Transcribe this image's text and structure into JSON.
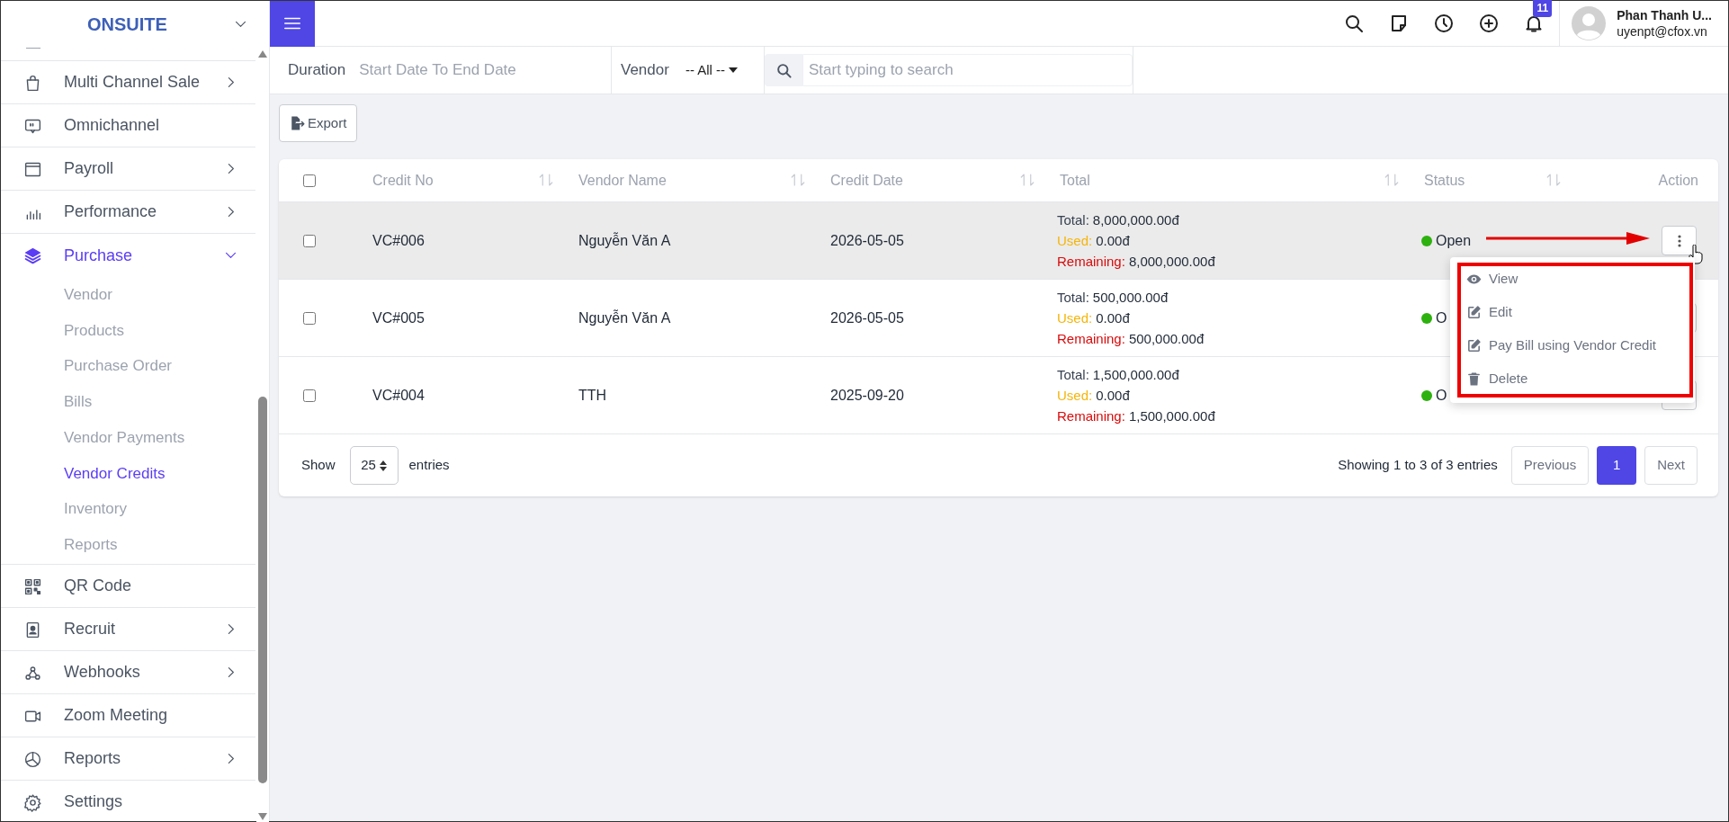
{
  "sidebar": {
    "brand": "ONSUITE",
    "items": [
      {
        "label": "Multi Channel Sale",
        "expanded": false,
        "selected": false
      },
      {
        "label": "Omnichannel",
        "selected": false
      },
      {
        "label": "Payroll",
        "expanded": false,
        "selected": false
      },
      {
        "label": "Performance",
        "expanded": false,
        "selected": false
      },
      {
        "label": "Purchase",
        "expanded": true,
        "selected": true,
        "children": [
          {
            "label": "Vendor",
            "selected": false
          },
          {
            "label": "Products",
            "selected": false
          },
          {
            "label": "Purchase Order",
            "selected": false
          },
          {
            "label": "Bills",
            "selected": false
          },
          {
            "label": "Vendor Payments",
            "selected": false
          },
          {
            "label": "Vendor Credits",
            "selected": true
          },
          {
            "label": "Inventory",
            "selected": false
          },
          {
            "label": "Reports",
            "selected": false
          }
        ]
      },
      {
        "label": "QR Code",
        "selected": false
      },
      {
        "label": "Recruit",
        "expanded": false,
        "selected": false
      },
      {
        "label": "Webhooks",
        "expanded": false,
        "selected": false
      },
      {
        "label": "Zoom Meeting",
        "selected": false
      },
      {
        "label": "Reports",
        "expanded": false,
        "selected": false
      },
      {
        "label": "Settings",
        "selected": false
      }
    ]
  },
  "topbar": {
    "notification_count": "11",
    "user_name": "Phan Thanh U...",
    "user_email": "uyenpt@cfox.vn"
  },
  "filters": {
    "duration_label": "Duration",
    "duration_placeholder": "Start Date To End Date",
    "vendor_label": "Vendor",
    "vendor_value": "-- All --",
    "search_placeholder": "Start typing to search"
  },
  "export_button": "Export",
  "table": {
    "select_all_checked": false,
    "columns": [
      {
        "label": "Credit No",
        "sortable": true
      },
      {
        "label": "Vendor Name",
        "sortable": true
      },
      {
        "label": "Credit Date",
        "sortable": true
      },
      {
        "label": "Total",
        "sortable": true
      },
      {
        "label": "Status",
        "sortable": true
      },
      {
        "label": "Action",
        "sortable": false
      }
    ],
    "rows": [
      {
        "checked": false,
        "highlighted": true,
        "credit_no": "VC#006",
        "vendor": "Nguyễn Văn A",
        "date": "2026-05-05",
        "amounts": [
          {
            "kind": "total",
            "label": "Total:",
            "value": "8,000,000.00đ"
          },
          {
            "kind": "used",
            "label": "Used:",
            "value": "0.00đ"
          },
          {
            "kind": "remaining",
            "label": "Remaining:",
            "value": "8,000,000.00đ"
          }
        ],
        "status": "Open"
      },
      {
        "checked": false,
        "highlighted": false,
        "credit_no": "VC#005",
        "vendor": "Nguyễn Văn A",
        "date": "2026-05-05",
        "amounts": [
          {
            "kind": "total",
            "label": "Total:",
            "value": "500,000.00đ"
          },
          {
            "kind": "used",
            "label": "Used:",
            "value": "0.00đ"
          },
          {
            "kind": "remaining",
            "label": "Remaining:",
            "value": "500,000.00đ"
          }
        ],
        "status": "O"
      },
      {
        "checked": false,
        "highlighted": false,
        "credit_no": "VC#004",
        "vendor": "TTH",
        "date": "2025-09-20",
        "amounts": [
          {
            "kind": "total",
            "label": "Total:",
            "value": "1,500,000.00đ"
          },
          {
            "kind": "used",
            "label": "Used:",
            "value": "0.00đ"
          },
          {
            "kind": "remaining",
            "label": "Remaining:",
            "value": "1,500,000.00đ"
          }
        ],
        "status": "O"
      }
    ]
  },
  "action_menu": {
    "items": [
      {
        "label": "View"
      },
      {
        "label": "Edit"
      },
      {
        "label": "Pay Bill using Vendor Credit"
      },
      {
        "label": "Delete"
      }
    ]
  },
  "footer": {
    "show_label": "Show",
    "page_size": "25",
    "entries_label": "entries",
    "info": "Showing 1 to 3 of 3 entries",
    "previous": "Previous",
    "pages": [
      {
        "label": "1",
        "selected": true
      }
    ],
    "next": "Next"
  }
}
